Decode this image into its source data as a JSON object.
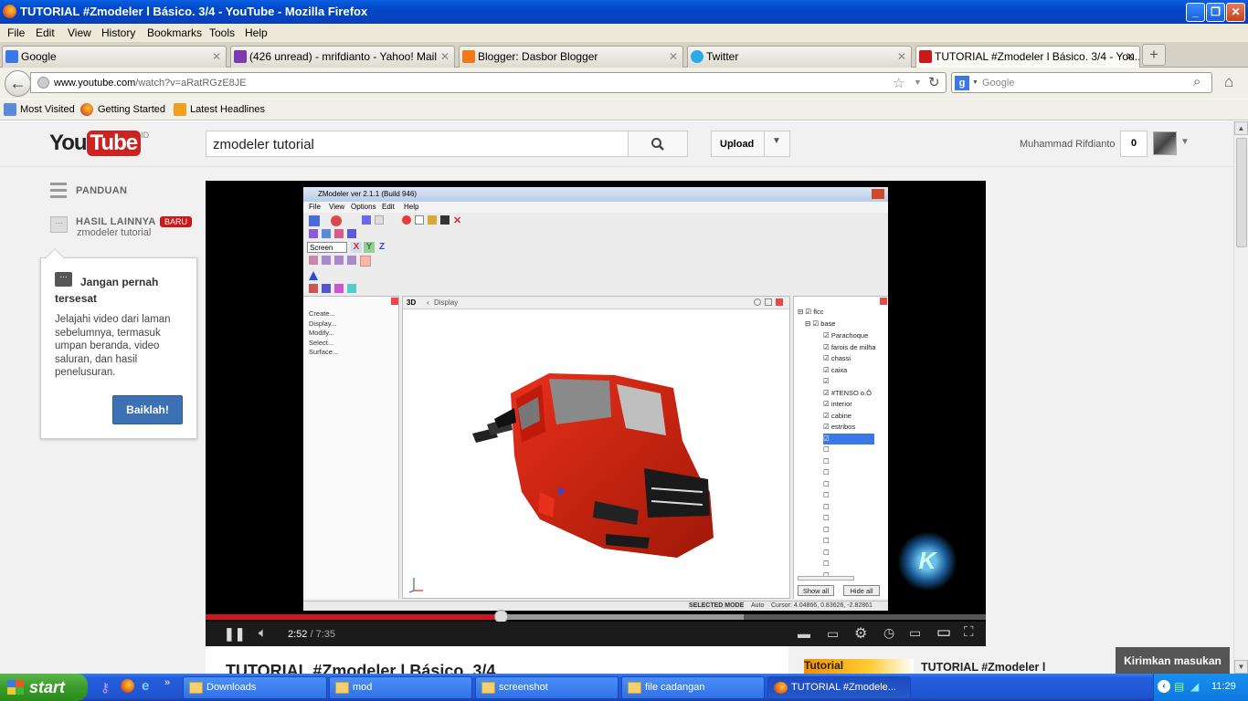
{
  "window": {
    "title": "TUTORIAL #Zmodeler l Básico. 3/4 - YouTube - Mozilla Firefox"
  },
  "menu": [
    "File",
    "Edit",
    "View",
    "History",
    "Bookmarks",
    "Tools",
    "Help"
  ],
  "tabs": [
    {
      "label": "Google",
      "icon": "google-icon",
      "color": "#3a78e8"
    },
    {
      "label": "(426 unread) - mrifdianto - Yahoo! Mail",
      "icon": "mail-icon",
      "color": "#7a3ab0"
    },
    {
      "label": "Blogger: Dasbor Blogger",
      "icon": "blogger-icon",
      "color": "#f07a1a"
    },
    {
      "label": "Twitter",
      "icon": "twitter-icon",
      "color": "#2aa8e8"
    },
    {
      "label": "TUTORIAL #Zmodeler l Básico. 3/4 - You...",
      "icon": "youtube-icon",
      "color": "#cc1818"
    }
  ],
  "nav": {
    "url_host": "www.youtube.com",
    "url_path": "/watch?v=aRatRGzE8JE",
    "search_placeholder": "Google"
  },
  "bookmarks": [
    "Most Visited",
    "Getting Started",
    "Latest Headlines"
  ],
  "youtube": {
    "logo_you": "You",
    "logo_tube": "Tube",
    "logo_region": "ID",
    "search_query": "zmodeler tutorial",
    "upload_label": "Upload",
    "username": "Muhammad Rifdianto",
    "notification_count": "0"
  },
  "sidebar": {
    "panduan": "PANDUAN",
    "hasil_label": "HASIL LAINNYA",
    "hasil_badge": "BARU",
    "hasil_sub": "zmodeler tutorial"
  },
  "popup": {
    "heading": "Jangan pernah tersesat",
    "body": "Jelajahi video dari laman sebelumnya, termasuk umpan beranda, video saluran, dan hasil penelusuran.",
    "button": "Baiklah!"
  },
  "player": {
    "time_current": "2:52",
    "time_total": "/ 7:35",
    "played_fraction": 0.378,
    "loaded_fraction": 0.69
  },
  "zmodeler": {
    "title": "ZModeler ver 2.1.1 (Build 946)",
    "menu": [
      "File",
      "View",
      "Options",
      "Edit",
      "Help"
    ],
    "view_label": "3D",
    "display_label": "Display",
    "left_menu": [
      "Create...",
      "Display...",
      "Modify...",
      "Select...",
      "Surface..."
    ],
    "screen_select": "Screen",
    "axes": [
      "X",
      "Y",
      "Z"
    ],
    "tree_root": "flcc",
    "tree_base": "base",
    "tree_items": [
      "Parachoque",
      "farois de milha",
      "chassi",
      "caixa",
      "",
      "#TENSO o.Ô",
      "interior",
      "cabine",
      "estribos"
    ],
    "show_all": "Show all",
    "hide_all": "Hide all",
    "status_mode": "SELECTED MODE",
    "status_auto": "Auto",
    "status_cursor": "Cursor: 4.04866, 0.83626, -2.82861"
  },
  "below": {
    "video_title": "TUTORIAL #Zmodeler l Básico. 3/4",
    "related_title": "TUTORIAL #Zmodeler l",
    "related_thumb": "Tutorial",
    "feedback": "Kirimkan masukan"
  },
  "taskbar": {
    "start": "start",
    "items": [
      "Downloads",
      "mod",
      "screenshot",
      "file cadangan",
      "TUTORIAL #Zmodele..."
    ],
    "clock": "11:29"
  }
}
